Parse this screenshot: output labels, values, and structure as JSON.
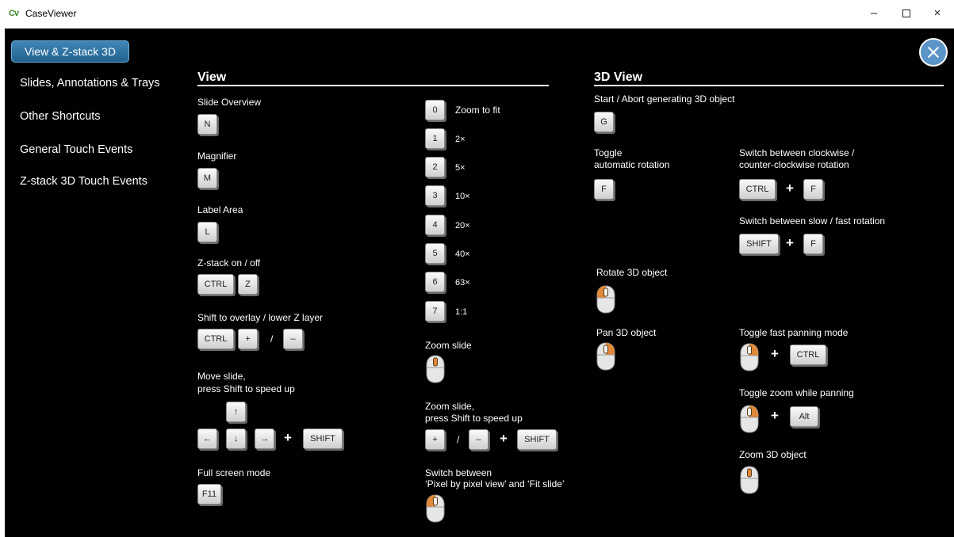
{
  "window": {
    "icon_label": "Cv",
    "title": "CaseViewer",
    "minimize_glyph": "–",
    "close_glyph": "×"
  },
  "nav": {
    "active": "View & Z-stack 3D",
    "items": [
      "Slides, Annotations & Trays",
      "Other Shortcuts",
      "General Touch Events",
      "Z-stack 3D Touch Events"
    ]
  },
  "view": {
    "title": "View",
    "slide_overview": {
      "label": "Slide Overview",
      "key": "N"
    },
    "magnifier": {
      "label": "Magnifier",
      "key": "M"
    },
    "label_area": {
      "label": "Label Area",
      "key": "L"
    },
    "zstack": {
      "label": "Z-stack on / off",
      "keys": [
        "CTRL",
        "Z"
      ]
    },
    "shift_layer": {
      "label": "Shift to overlay / lower Z layer",
      "keys": [
        "CTRL",
        "+",
        "–"
      ],
      "sep": "/"
    },
    "move_slide": {
      "label_line1": "Move slide,",
      "label_line2": "press Shift to speed up",
      "keys": [
        "↑",
        "←",
        "↓",
        "→",
        "SHIFT"
      ],
      "plus": "+"
    },
    "fullscreen": {
      "label": "Full screen mode",
      "key": "F11"
    },
    "zoom_levels": [
      {
        "key": "0",
        "label": "Zoom to fit"
      },
      {
        "key": "1",
        "label": "2×"
      },
      {
        "key": "2",
        "label": "5×"
      },
      {
        "key": "3",
        "label": "10×"
      },
      {
        "key": "4",
        "label": "20×"
      },
      {
        "key": "5",
        "label": "40×"
      },
      {
        "key": "6",
        "label": "63×"
      },
      {
        "key": "7",
        "label": "1:1"
      }
    ],
    "zoom_slide": {
      "label": "Zoom slide"
    },
    "zoom_slide_shift": {
      "label_line1": "Zoom slide,",
      "label_line2": "press Shift to speed up",
      "keys": [
        "+",
        "–",
        "SHIFT"
      ],
      "sep": "/",
      "plus": "+"
    },
    "switch_view": {
      "label_line1": "Switch between",
      "label_line2": "‘Pixel by pixel view’ and ‘Fit slide’"
    }
  },
  "view3d": {
    "title": "3D View",
    "start_abort": {
      "label": "Start / Abort generating 3D object",
      "key": "G"
    },
    "toggle_rotation": {
      "label_line1": "Toggle",
      "label_line2": "automatic rotation",
      "key": "F"
    },
    "switch_direction": {
      "label_line1": "Switch between clockwise /",
      "label_line2": "counter-clockwise rotation",
      "keys": [
        "CTRL",
        "F"
      ],
      "plus": "+"
    },
    "switch_speed": {
      "label": "Switch between slow / fast rotation",
      "keys": [
        "SHIFT",
        "F"
      ],
      "plus": "+"
    },
    "rotate": {
      "label": "Rotate 3D object"
    },
    "pan": {
      "label": "Pan 3D object"
    },
    "fast_panning": {
      "label": "Toggle fast panning mode",
      "key": "CTRL",
      "plus": "+"
    },
    "zoom_while_panning": {
      "label": "Toggle zoom while panning",
      "key": "Alt",
      "plus": "+"
    },
    "zoom_3d": {
      "label": "Zoom 3D object"
    }
  },
  "colors": {
    "accent": "#3f86b8",
    "mouse_highlight": "#e0893a"
  }
}
